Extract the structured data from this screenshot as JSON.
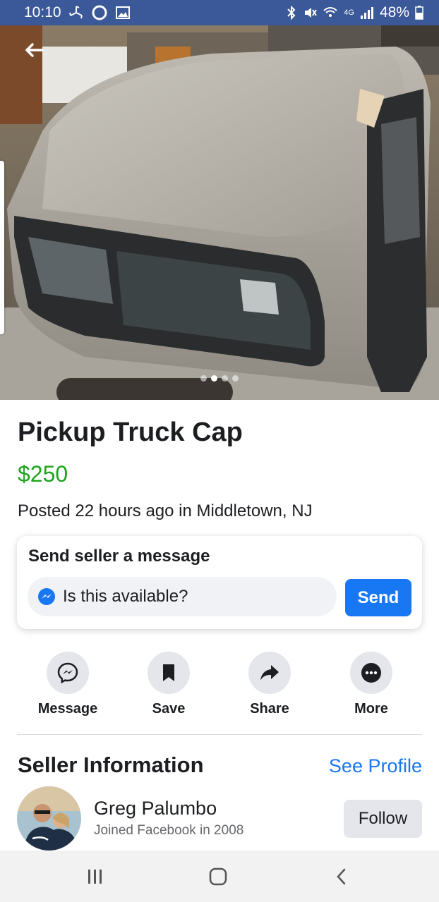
{
  "status_bar": {
    "time": "10:10",
    "battery": "48%",
    "network": "4G",
    "left_icons": [
      "fan-icon",
      "circle-icon",
      "gallery-icon"
    ],
    "right_icons": [
      "bluetooth-icon",
      "mute-icon",
      "wifi-icon",
      "signal-icon",
      "battery-icon"
    ]
  },
  "hero": {
    "photo_description_icon": "truck-cap-photo",
    "page_count": 4,
    "active_page": 2
  },
  "listing": {
    "title": "Pickup Truck Cap",
    "price": "$250",
    "posted": "Posted 22 hours ago in Middletown, NJ",
    "price_color": "#1ea41e"
  },
  "message_card": {
    "title": "Send seller a message",
    "input_value": "Is this available?",
    "send_label": "Send"
  },
  "actions": [
    {
      "label": "Message",
      "icon": "messenger-icon"
    },
    {
      "label": "Save",
      "icon": "bookmark-icon"
    },
    {
      "label": "Share",
      "icon": "share-icon"
    },
    {
      "label": "More",
      "icon": "more-icon"
    }
  ],
  "seller": {
    "heading": "Seller Information",
    "see_profile": "See Profile",
    "name": "Greg Palumbo",
    "joined": "Joined Facebook in 2008",
    "follow_label": "Follow"
  },
  "colors": {
    "status_bar": "#3b5998",
    "accent": "#1877f2",
    "price": "#1ea41e"
  }
}
